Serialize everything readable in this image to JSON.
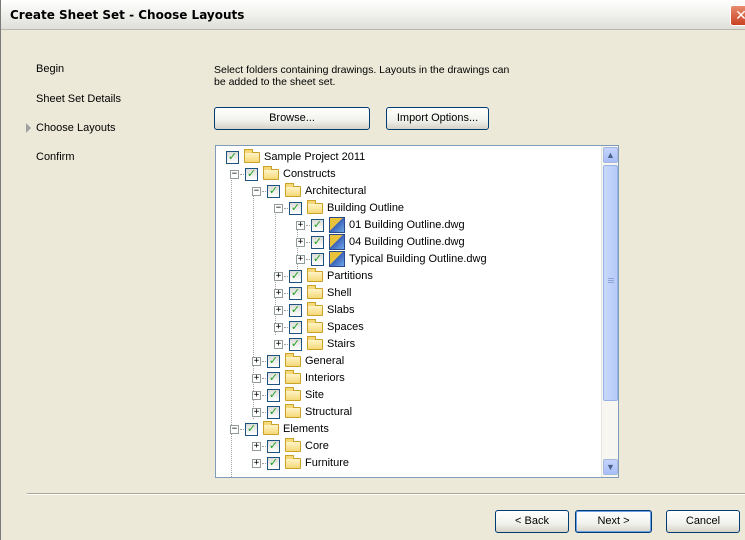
{
  "window": {
    "title": "Create Sheet Set - Choose Layouts",
    "close_glyph": "✕"
  },
  "steps": [
    {
      "label": "Begin",
      "active": false
    },
    {
      "label": "Sheet Set Details",
      "active": false
    },
    {
      "label": "Choose Layouts",
      "active": true
    },
    {
      "label": "Confirm",
      "active": false
    }
  ],
  "instructions": "Select folders containing drawings.  Layouts in the drawings can be added to the sheet set.",
  "buttons": {
    "browse": "Browse...",
    "import_options": "Import Options...",
    "back": "< Back",
    "next": "Next >",
    "cancel": "Cancel"
  },
  "tree": {
    "items": [
      {
        "label": "Sample Project 2011",
        "kind": "folder",
        "depth": 0,
        "expander": "",
        "checked": true
      },
      {
        "label": "Constructs",
        "kind": "folder",
        "depth": 1,
        "expander": "−",
        "checked": true
      },
      {
        "label": "Architectural",
        "kind": "folder",
        "depth": 2,
        "expander": "−",
        "checked": true
      },
      {
        "label": "Building Outline",
        "kind": "folder",
        "depth": 3,
        "expander": "−",
        "checked": true
      },
      {
        "label": "01 Building Outline.dwg",
        "kind": "file",
        "depth": 4,
        "expander": "+",
        "checked": true
      },
      {
        "label": "04 Building Outline.dwg",
        "kind": "file",
        "depth": 4,
        "expander": "+",
        "checked": true
      },
      {
        "label": "Typical Building Outline.dwg",
        "kind": "file",
        "depth": 4,
        "expander": "+",
        "checked": true
      },
      {
        "label": "Partitions",
        "kind": "folder",
        "depth": 3,
        "expander": "+",
        "checked": true
      },
      {
        "label": "Shell",
        "kind": "folder",
        "depth": 3,
        "expander": "+",
        "checked": true
      },
      {
        "label": "Slabs",
        "kind": "folder",
        "depth": 3,
        "expander": "+",
        "checked": true
      },
      {
        "label": "Spaces",
        "kind": "folder",
        "depth": 3,
        "expander": "+",
        "checked": true
      },
      {
        "label": "Stairs",
        "kind": "folder",
        "depth": 3,
        "expander": "+",
        "checked": true
      },
      {
        "label": "General",
        "kind": "folder",
        "depth": 2,
        "expander": "+",
        "checked": true
      },
      {
        "label": "Interiors",
        "kind": "folder",
        "depth": 2,
        "expander": "+",
        "checked": true
      },
      {
        "label": "Site",
        "kind": "folder",
        "depth": 2,
        "expander": "+",
        "checked": true
      },
      {
        "label": "Structural",
        "kind": "folder",
        "depth": 2,
        "expander": "+",
        "checked": true
      },
      {
        "label": "Elements",
        "kind": "folder",
        "depth": 1,
        "expander": "−",
        "checked": true
      },
      {
        "label": "Core",
        "kind": "folder",
        "depth": 2,
        "expander": "+",
        "checked": true
      },
      {
        "label": "Furniture",
        "kind": "folder",
        "depth": 2,
        "expander": "+",
        "checked": true
      }
    ],
    "scroll_up_glyph": "▲",
    "scroll_down_glyph": "▼"
  },
  "colors": {
    "dialog_bg": "#ece9d8",
    "check_green": "#21a121",
    "button_border": "#003c74",
    "close_red": "#c94223"
  }
}
